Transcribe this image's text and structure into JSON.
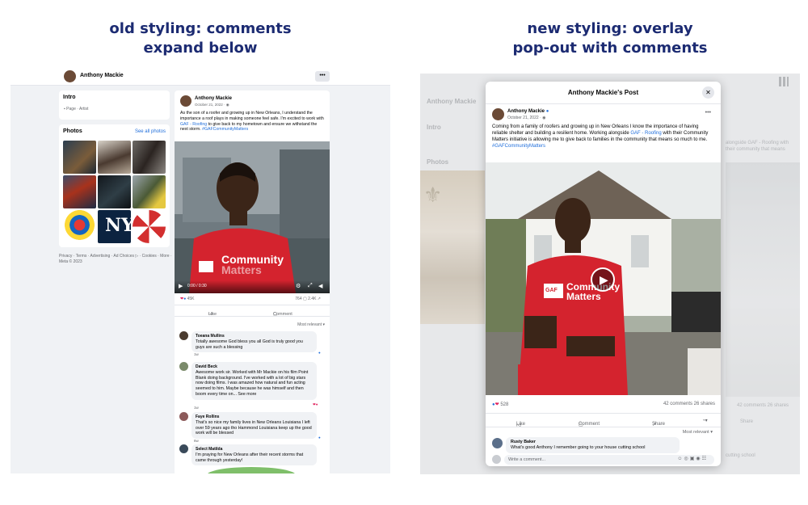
{
  "headings": {
    "old_line1": "old styling: comments",
    "old_line2": "expand below",
    "new_line1": "new styling: overlay",
    "new_line2": "pop-out with comments"
  },
  "old": {
    "page_name": "Anthony Mackie",
    "more_label": "•••",
    "intro_title": "Intro",
    "intro_sub": "Page · Artist",
    "photos_title": "Photos",
    "see_all": "See all photos",
    "footer": "Privacy · Terms · Advertising · Ad Choices ▷ · Cookies · More · Meta © 2023",
    "post": {
      "author": "Anthony Mackie",
      "date": "October 21, 2022 · ",
      "text_before": "As the son of a roofer and growing up in New Orleans, I understand the importance a roof plays in making someone feel safe. I'm excited to work with ",
      "link": "GAF - Roofing",
      "text_after": " to give back to my hometown and ensure we withstand the next storm. ",
      "hashtag": "#GAFCommunityMatters",
      "reactions": "45K",
      "counts": "764 ▢   2.4K ↗",
      "like": "Like",
      "comment": "Comment",
      "most_relevant": "Most relevant ▾",
      "shirt_line1": "Community",
      "shirt_line2": "Matters",
      "video_time": "0:00 / 0:30"
    },
    "comments": [
      {
        "name": "Toeana Mullins",
        "text": "Totally awesome God bless you all God is truly good you guys are such a blessing",
        "age": "1w"
      },
      {
        "name": "David Beck",
        "text": "Awesome work sir. Worked with Mr Mackie on his film Point Blank doing background. I've worked with a lot of big stars now doing films. I was amazed how natural and fun acting seemed to him. Maybe because he was himself and then boom every time on... See more",
        "age": "1w"
      },
      {
        "name": "Faye Rollins",
        "text": "That's so nice my family lives in New Orleans Louisiana I left over 59 years ago tho Hammond Louisiana keep up the good work will be blessed",
        "age": "6w"
      },
      {
        "name": "Select Matilda",
        "text": "I'm praying for New Orleans after their recent storms that came through yesterday!",
        "age": ""
      }
    ]
  },
  "new": {
    "modal_title": "Anthony Mackie's Post",
    "close": "✕",
    "author": "Anthony Mackie",
    "date": "October 21, 2022 · ",
    "dots": "•••",
    "text_before": "Coming from a family of roofers and growing up in New Orleans I know the importance of having reliable shelter and building a resilient home. Working alongside ",
    "link": "GAF - Roofing",
    "text_after": " with their Community Matters initiative is allowing me to give back to families in the community that means so much to me. ",
    "hashtag": "#GAFCommunityMatters",
    "reactions": "528",
    "counts": "42 comments   26 shares",
    "like": "Like",
    "comment": "Comment",
    "share": "Share",
    "most_relevant": "Most relevant ▾",
    "shirt_line1": "Community",
    "shirt_line2": "Matters",
    "gaf": "GAF",
    "comment_name": "Rusty Baker",
    "comment_text": "What's good Anthony I remember going to your house cutting school",
    "write_placeholder": "Write a comment...",
    "bg_page": "Anthony Mackie",
    "bg_intro": "Intro",
    "bg_photos": "Photos",
    "bg_text": "alongside GAF - Roofing with their community that means",
    "bg_comments": "42 comments  26 shares",
    "bg_share": "Share",
    "bg_school": "cutting school"
  },
  "colors": {
    "heading": "#1c2b72",
    "fb_blue": "#216fdb",
    "shirt_red": "#d4232e"
  }
}
